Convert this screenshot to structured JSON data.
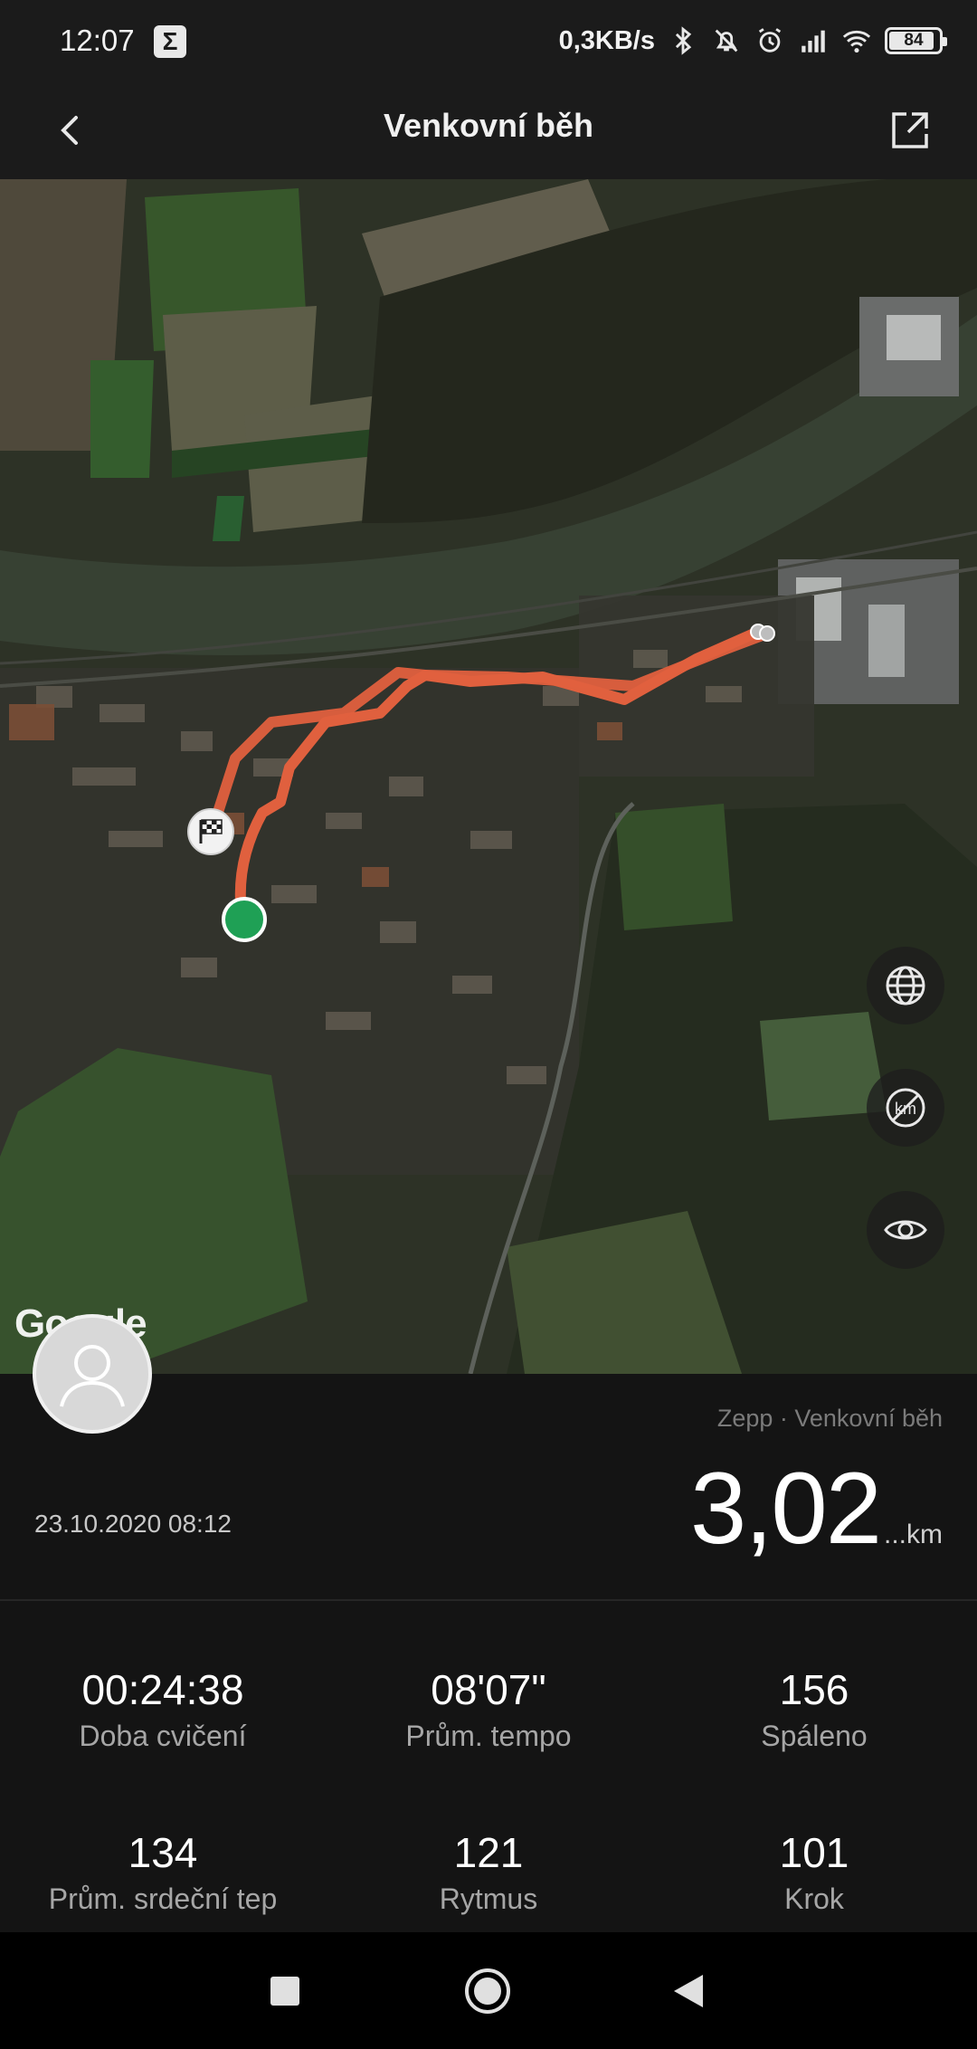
{
  "status_bar": {
    "time": "12:07",
    "notification_icon": "sigma-icon",
    "net_speed": "0,3KB/s",
    "icons": [
      "bluetooth-icon",
      "mute-bell-icon",
      "alarm-icon",
      "signal-icon",
      "wifi-icon"
    ],
    "battery_level": "84"
  },
  "app_bar": {
    "title": "Venkovní běh",
    "back_icon": "chevron-left-icon",
    "share_icon": "share-icon"
  },
  "map": {
    "attribution": "Google",
    "route_color": "#e0603e",
    "start_color": "#1fa055",
    "controls": [
      "globe-icon",
      "km-hidden-icon",
      "eye-icon"
    ]
  },
  "workout": {
    "source": "Zepp · Venkovní běh",
    "date": "23.10.2020 08:12",
    "distance": "3,02",
    "distance_unit": "...km"
  },
  "stats": [
    {
      "value": "00:24:38",
      "label": "Doba cvičení"
    },
    {
      "value": "08'07\"",
      "label": "Prům. tempo"
    },
    {
      "value": "156",
      "label": "Spáleno"
    },
    {
      "value": "134",
      "label": "Prům. srdeční tep"
    },
    {
      "value": "121",
      "label": "Rytmus"
    },
    {
      "value": "101",
      "label": "Krok"
    }
  ],
  "nav_bar": [
    "recents-square-icon",
    "home-circle-icon",
    "back-triangle-icon"
  ]
}
